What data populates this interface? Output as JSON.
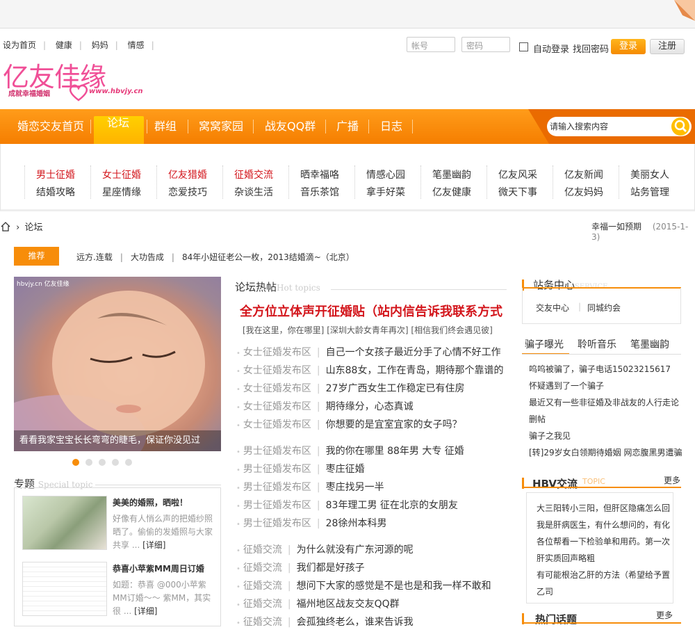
{
  "header": {
    "top_links": [
      "设为首页",
      "健康",
      "妈妈",
      "情感"
    ],
    "account_placeholder": "帐号",
    "password_placeholder": "密码",
    "auto_login": "自动登录",
    "find_password": "找回密码",
    "login_label": "登录",
    "register_label": "注册"
  },
  "logo": {
    "name": "亿友佳缘",
    "slogan": "成就幸福婚姻",
    "url": "www.hbvjy.cn"
  },
  "nav": {
    "items": [
      "婚恋交友首页",
      "论坛",
      "群组",
      "窝窝家园",
      "战友QQ群",
      "广播",
      "日志"
    ],
    "active": "论坛",
    "search_placeholder": "请输入搜索内容"
  },
  "subnav": {
    "columns": [
      [
        "男士征婚",
        "结婚攻略"
      ],
      [
        "女士征婚",
        "星座情缘"
      ],
      [
        "亿友猎婚",
        "恋爱技巧"
      ],
      [
        "征婚交流",
        "杂谈生活"
      ],
      [
        "晒幸福咯",
        "音乐茶馆"
      ],
      [
        "情感心园",
        "拿手好菜"
      ],
      [
        "笔墨幽韵",
        "亿友健康"
      ],
      [
        "亿友风采",
        "微天下事"
      ],
      [
        "亿友新闻",
        "亿友妈妈"
      ],
      [
        "美丽女人",
        "站务管理"
      ]
    ]
  },
  "breadcrumb": {
    "label": "论坛",
    "right_title": "幸福一如预期",
    "right_date": "(2015-1-3)"
  },
  "recommend": {
    "tag": "推荐",
    "items": [
      "远方.连载",
      "大功告成",
      "84年小妞征老公一枚，2013结婚滴~（北京）"
    ]
  },
  "slider": {
    "caption": "看看我家宝宝长长弯弯的睫毛，保证你没见过",
    "watermark": "hbvjy.cn 亿友佳缘",
    "total": 5,
    "active": 0
  },
  "special": {
    "title": "专题",
    "title_en": "Special topic",
    "items": [
      {
        "title": "美美的婚照，晒啦！",
        "desc": "好像有人悄么声的把婚纱照晒了。偷偷的发婚照与大家共享 ...",
        "more": "[详细]"
      },
      {
        "title": "恭喜小苹紫MM周日订婚",
        "desc": "如题：恭喜 @000小苹紫MM订婚～～ 紫MM，其实很 ...",
        "more": "[详细]"
      }
    ]
  },
  "hot": {
    "title": "论坛热帖",
    "title_en": "Hot topics",
    "headline": "全方位立体声开征婚贴（站内信告诉我联系方式",
    "subheads": [
      "[我在这里，你在哪里]",
      "[深圳大龄女青年再次]",
      "[相信我们终会遇见彼]"
    ],
    "groups": [
      {
        "category": "女士征婚发布区",
        "titles": [
          "自己一个女孩子最近分手了心情不好工作",
          "山东88女，工作在青岛，期待那个靠谱的",
          "27岁广西女生工作稳定已有住房",
          "期待缘分，心态真诚",
          "你想要的是宜室宜家的女子吗？"
        ]
      },
      {
        "category": "男士征婚发布区",
        "titles": [
          "我的你在哪里 88年男 大专 征婚",
          "枣庄征婚",
          "枣庄找另一半",
          "83年理工男 征在北京的女朋友",
          "28徐州本科男"
        ]
      },
      {
        "category": "征婚交流",
        "titles": [
          "为什么就没有广东河源的呢",
          "我们都是好孩子",
          "想问下大家的感觉是不是也是和我一样不敢和",
          "福州地区战友交友QQ群",
          "会孤独终老么，谁来告诉我"
        ]
      }
    ]
  },
  "service": {
    "title": "站务中心",
    "title_en": "SERVICE",
    "links": [
      "交友中心",
      "同城约会"
    ]
  },
  "tabs": {
    "labels": [
      "骗子曝光",
      "聆听音乐",
      "笔墨幽韵"
    ],
    "active": 0,
    "items": [
      "呜呜被骗了，骗子电话15023215617",
      "怀疑遇到了一个骗子",
      "最近又有一些非征婚及非战友的人行走论",
      "删帖",
      "骗子之我见",
      "[转]29岁女白领期待婚姻 网恋腹黑男遭骗"
    ]
  },
  "hbv": {
    "title": "HBV交流",
    "title_en": "TOPIC",
    "more": "更多",
    "items": [
      "大三阳转小三阳，但肝区隐痛怎么回",
      "我是肝病医生，有什么想问的，有化",
      "各位帮看一下检验单和用药。第一次",
      "肝实质回声略粗",
      "有可能根治乙肝的方法（希望给予置",
      "乙司"
    ]
  },
  "hottopic": {
    "title": "热门话题",
    "more": "更多"
  },
  "colors": {
    "brand_orange": "#f78d0a",
    "headline_red": "#d3161c",
    "logo_pink": "#f04f97"
  }
}
